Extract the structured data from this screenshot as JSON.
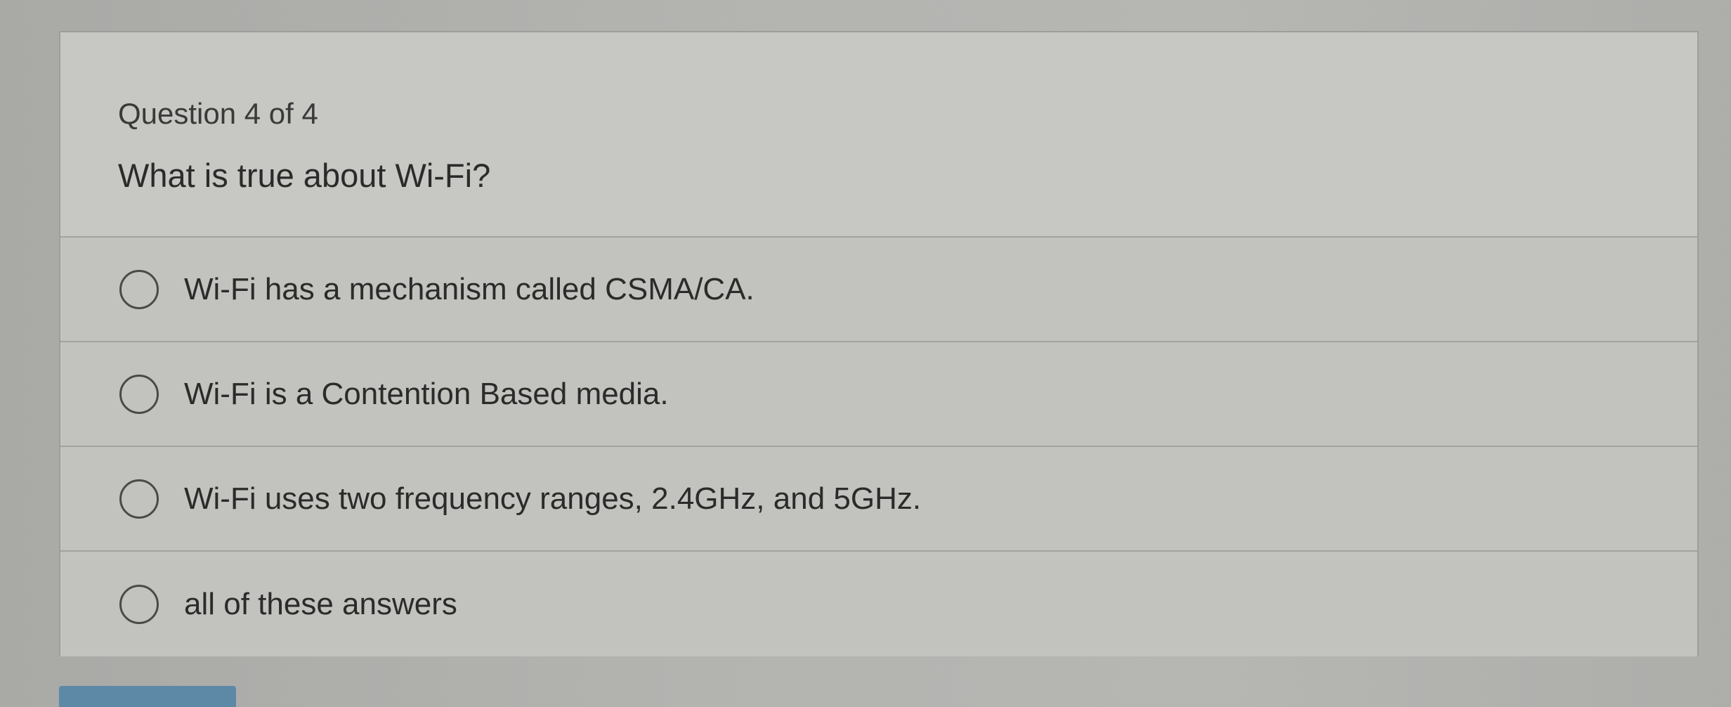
{
  "quiz": {
    "counter": "Question 4 of 4",
    "question": "What is true about Wi-Fi?",
    "options": [
      {
        "label": "Wi-Fi has a mechanism called CSMA/CA.",
        "selected": false
      },
      {
        "label": "Wi-Fi is a Contention Based media.",
        "selected": false
      },
      {
        "label": "Wi-Fi uses two frequency ranges, 2.4GHz, and 5GHz.",
        "selected": false
      },
      {
        "label": "all of these answers",
        "selected": false
      }
    ]
  },
  "colors": {
    "background": "#b3b3b0",
    "card": "#c4c4c0",
    "text": "#2b2b2b",
    "button": "#5d89a6"
  }
}
